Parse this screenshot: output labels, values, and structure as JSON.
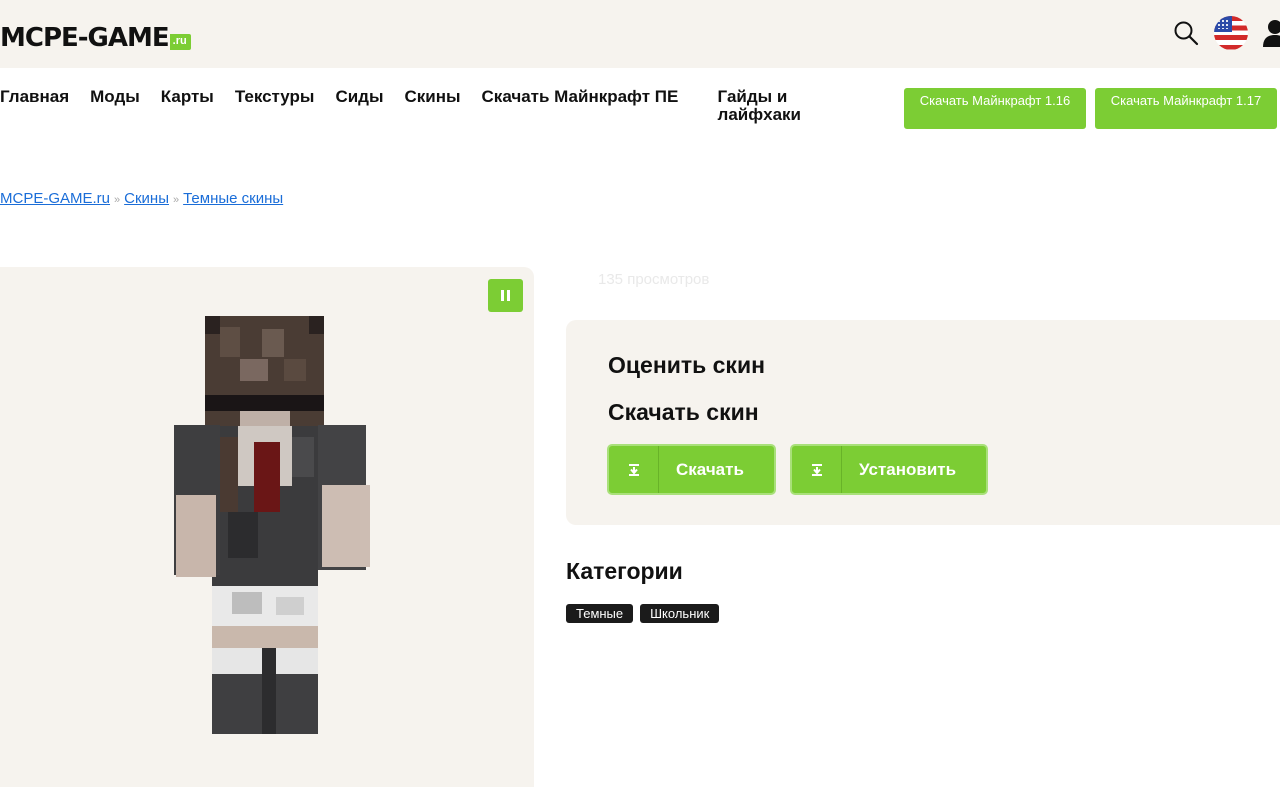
{
  "site": {
    "logo_main": "MCPE-GAME",
    "logo_suffix": ".ru"
  },
  "colors": {
    "accent": "#7ccd34",
    "panel_bg": "#f6f3ee",
    "link": "#1a6dd8",
    "tag_bg": "#1b1b1b"
  },
  "nav": {
    "items": [
      {
        "label": "Главная"
      },
      {
        "label": "Моды"
      },
      {
        "label": "Карты"
      },
      {
        "label": "Текстуры"
      },
      {
        "label": "Сиды"
      },
      {
        "label": "Скины"
      },
      {
        "label": "Скачать Майнкрафт ПЕ"
      },
      {
        "label": "Гайды и лайфхаки"
      }
    ],
    "download_buttons": [
      {
        "label": "Скачать Майнкрафт 1.16"
      },
      {
        "label": "Скачать Майнкрафт 1.17"
      }
    ]
  },
  "icons": {
    "search": "search-icon",
    "language": "us-flag-icon",
    "user": "user-icon",
    "pause": "pause-icon",
    "download": "download-icon"
  },
  "breadcrumb": {
    "items": [
      "MCPE-GAME.ru",
      "Скины",
      "Темные скины"
    ],
    "separator": "»"
  },
  "skin": {
    "views": "135 просмотров"
  },
  "panel": {
    "rate_title": "Оценить скин",
    "download_title": "Скачать скин",
    "download_label": "Скачать",
    "install_label": "Установить"
  },
  "categories": {
    "title": "Категории",
    "tags": [
      "Темные",
      "Школьник"
    ]
  }
}
